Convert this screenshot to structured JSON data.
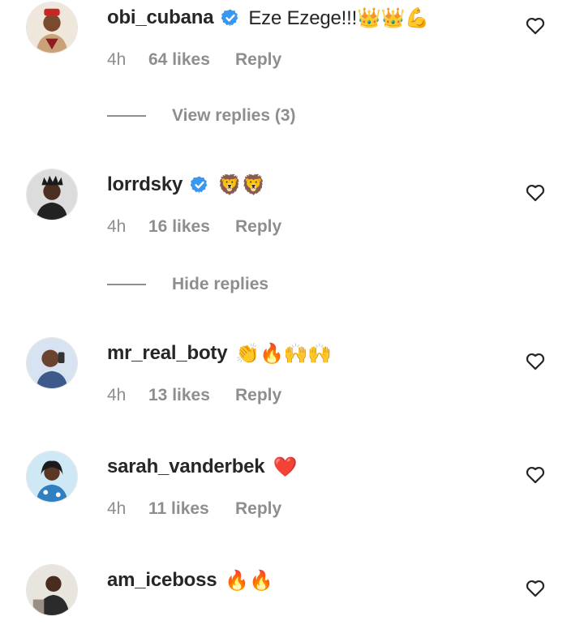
{
  "comments": [
    {
      "username": "obi_cubana",
      "verified": true,
      "text": "Eze Ezege!!!👑👑💪",
      "time": "4h",
      "likes": "64 likes",
      "reply": "Reply",
      "thread_toggle": "View replies (3)"
    },
    {
      "username": "lorrdsky",
      "verified": true,
      "text": "🦁🦁",
      "time": "4h",
      "likes": "16 likes",
      "reply": "Reply",
      "thread_toggle": "Hide replies"
    },
    {
      "username": "mr_real_boty",
      "verified": false,
      "text": "👏🔥🙌🙌",
      "time": "4h",
      "likes": "13 likes",
      "reply": "Reply"
    },
    {
      "username": "sarah_vanderbek",
      "verified": false,
      "text": "❤️",
      "time": "4h",
      "likes": "11 likes",
      "reply": "Reply"
    },
    {
      "username": "am_iceboss",
      "verified": false,
      "text": "🔥🔥",
      "time": "",
      "likes": "",
      "reply": ""
    }
  ],
  "icons": {
    "verified": "verified-badge-icon",
    "like": "heart-outline-icon"
  },
  "colors": {
    "username": "#262626",
    "meta": "#8e8e8e",
    "verified_badge": "#3897f0"
  }
}
